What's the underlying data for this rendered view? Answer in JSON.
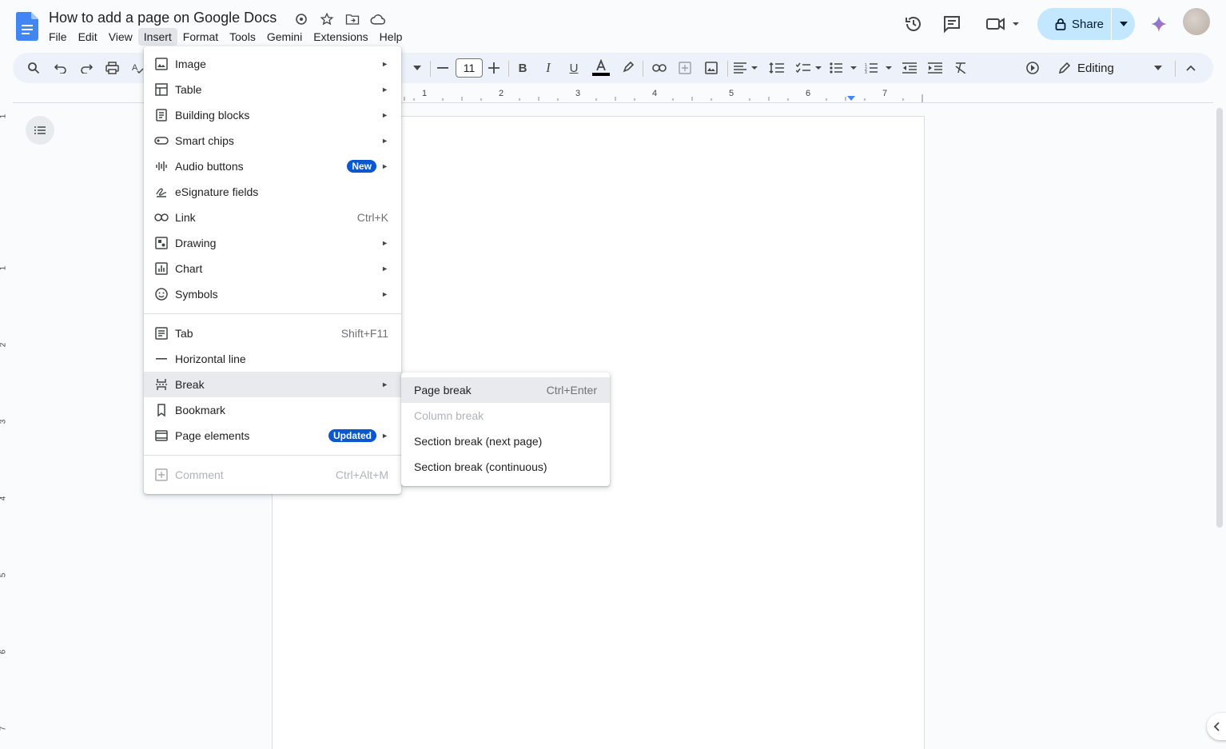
{
  "doc": {
    "title": "How to add a page on Google Docs"
  },
  "menubar": [
    "File",
    "Edit",
    "View",
    "Insert",
    "Format",
    "Tools",
    "Gemini",
    "Extensions",
    "Help"
  ],
  "active_menu": "Insert",
  "share": {
    "label": "Share"
  },
  "toolbar": {
    "font_size": "11",
    "mode": "Editing"
  },
  "ruler": {
    "numbers": [
      "1",
      "2",
      "3",
      "4",
      "5",
      "6",
      "7"
    ]
  },
  "vruler": {
    "numbers": [
      "1",
      "1",
      "2",
      "3",
      "4",
      "5",
      "6",
      "7"
    ]
  },
  "insert_menu": {
    "group1": [
      {
        "label": "Image",
        "icon": "image-icon",
        "arrow": true
      },
      {
        "label": "Table",
        "icon": "table-icon",
        "arrow": true
      },
      {
        "label": "Building blocks",
        "icon": "building-blocks-icon",
        "arrow": true
      },
      {
        "label": "Smart chips",
        "icon": "smart-chips-icon",
        "arrow": true
      },
      {
        "label": "Audio buttons",
        "icon": "audio-icon",
        "arrow": true,
        "badge": "New"
      },
      {
        "label": "eSignature fields",
        "icon": "signature-icon"
      },
      {
        "label": "Link",
        "icon": "link-icon",
        "shortcut": "Ctrl+K"
      },
      {
        "label": "Drawing",
        "icon": "drawing-icon",
        "arrow": true
      },
      {
        "label": "Chart",
        "icon": "chart-icon",
        "arrow": true
      },
      {
        "label": "Symbols",
        "icon": "symbols-icon",
        "arrow": true
      }
    ],
    "group2": [
      {
        "label": "Tab",
        "icon": "tab-icon",
        "shortcut": "Shift+F11"
      },
      {
        "label": "Horizontal line",
        "icon": "horizontal-line-icon"
      },
      {
        "label": "Break",
        "icon": "break-icon",
        "arrow": true,
        "highlighted": true
      },
      {
        "label": "Bookmark",
        "icon": "bookmark-icon"
      },
      {
        "label": "Page elements",
        "icon": "page-elements-icon",
        "arrow": true,
        "badge": "Updated"
      }
    ],
    "group3": [
      {
        "label": "Comment",
        "icon": "comment-icon",
        "shortcut": "Ctrl+Alt+M",
        "disabled": true
      }
    ]
  },
  "break_menu": [
    {
      "label": "Page break",
      "shortcut": "Ctrl+Enter",
      "highlighted": true
    },
    {
      "label": "Column break",
      "disabled": true
    },
    {
      "label": "Section break (next page)"
    },
    {
      "label": "Section break (continuous)"
    }
  ],
  "colors": {
    "accent": "#0b57d0",
    "share_bg": "#c2e7ff",
    "toolbar_bg": "#edf2fa",
    "background": "#f9fbfd"
  }
}
